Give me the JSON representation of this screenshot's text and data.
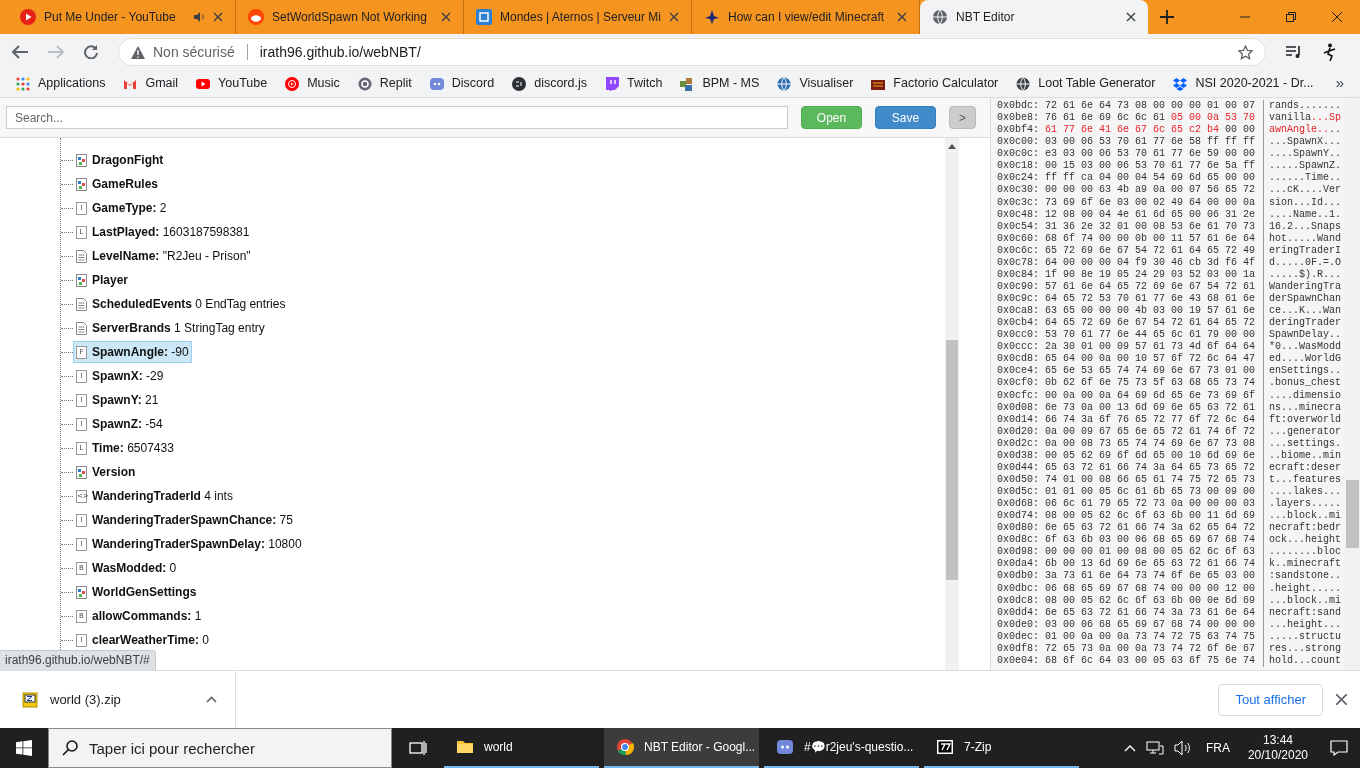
{
  "browser": {
    "tabs": [
      {
        "title": "Put Me Under - YouTube",
        "selected": false,
        "audio": true
      },
      {
        "title": "SetWorldSpawn Not Working",
        "selected": false,
        "audio": false
      },
      {
        "title": "Mondes | Aternos | Serveur Mi",
        "selected": false,
        "audio": false
      },
      {
        "title": "How can I view/edit Minecraft",
        "selected": false,
        "audio": false
      },
      {
        "title": "NBT Editor",
        "selected": true,
        "audio": false
      }
    ],
    "security": "Non sécurisé",
    "url": "irath96.github.io/webNBT/",
    "bookmarks": [
      {
        "label": "Applications"
      },
      {
        "label": "Gmail"
      },
      {
        "label": "YouTube"
      },
      {
        "label": "Music"
      },
      {
        "label": "Replit"
      },
      {
        "label": "Discord"
      },
      {
        "label": "discord.js"
      },
      {
        "label": "Twitch"
      },
      {
        "label": "BPM - MS"
      },
      {
        "label": "Visualiser"
      },
      {
        "label": "Factorio Calculator"
      },
      {
        "label": "Loot Table Generator"
      },
      {
        "label": "NSI 2020-2021 - Dr..."
      }
    ],
    "more": "»"
  },
  "toolbar": {
    "search": {
      "placeholder": "Search..."
    },
    "buttons": [
      {
        "label": "Open",
        "kind": "open"
      },
      {
        "label": "Save",
        "kind": "save"
      },
      {
        "label": ">",
        "kind": "toggle"
      }
    ]
  },
  "tree": {
    "items": [
      {
        "kind": "compound",
        "name": "DragonFight",
        "selected": false
      },
      {
        "kind": "compound",
        "name": "GameRules",
        "selected": false
      },
      {
        "kind": "tag",
        "letter": "I",
        "name": "GameType:",
        "value": "2",
        "selected": false
      },
      {
        "kind": "tag",
        "letter": "L",
        "name": "LastPlayed:",
        "value": "1603187598381",
        "selected": false
      },
      {
        "kind": "page",
        "name": "LevelName:",
        "value": "\"R2Jeu - Prison\"",
        "selected": false
      },
      {
        "kind": "compound",
        "name": "Player",
        "selected": false
      },
      {
        "kind": "page",
        "name": "ScheduledEvents",
        "value": "0 EndTag entries",
        "selected": false
      },
      {
        "kind": "page",
        "name": "ServerBrands",
        "value": "1 StringTag entry",
        "selected": false
      },
      {
        "kind": "tag",
        "letter": "F",
        "name": "SpawnAngle:",
        "value": "-90",
        "selected": true
      },
      {
        "kind": "tag",
        "letter": "I",
        "name": "SpawnX:",
        "value": "-29",
        "selected": false
      },
      {
        "kind": "tag",
        "letter": "I",
        "name": "SpawnY:",
        "value": "21",
        "selected": false
      },
      {
        "kind": "tag",
        "letter": "I",
        "name": "SpawnZ:",
        "value": "-54",
        "selected": false
      },
      {
        "kind": "tag",
        "letter": "L",
        "name": "Time:",
        "value": "6507433",
        "selected": false
      },
      {
        "kind": "compound",
        "name": "Version",
        "selected": false
      },
      {
        "kind": "tag",
        "letter": "<>",
        "name": "WanderingTraderId",
        "value": "4 ints",
        "selected": false
      },
      {
        "kind": "tag",
        "letter": "I",
        "name": "WanderingTraderSpawnChance:",
        "value": "75",
        "selected": false
      },
      {
        "kind": "tag",
        "letter": "I",
        "name": "WanderingTraderSpawnDelay:",
        "value": "10800",
        "selected": false
      },
      {
        "kind": "tag",
        "letter": "B",
        "name": "WasModded:",
        "value": "0",
        "selected": false
      },
      {
        "kind": "compound",
        "name": "WorldGenSettings",
        "selected": false
      },
      {
        "kind": "tag",
        "letter": "B",
        "name": "allowCommands:",
        "value": "1",
        "selected": false
      },
      {
        "kind": "tag",
        "letter": "I",
        "name": "clearWeatherTime:",
        "value": "0",
        "selected": false
      }
    ]
  },
  "hex": {
    "rows": [
      {
        "offset": "0x0bdc:",
        "hex": [
          {
            "text": "72 61 6e 64 73 08 00 00 00 01 00 07",
            "marked": false
          }
        ],
        "ascii": [
          {
            "text": "rands.......",
            "marked": false
          }
        ]
      },
      {
        "offset": "0x0be8:",
        "hex": [
          {
            "text": "76 61 6e 69 6c 6c 61",
            "marked": false
          },
          {
            "text": "05 00 0a 53 70",
            "marked": true
          }
        ],
        "ascii": [
          {
            "text": "vanilla",
            "marked": false
          },
          {
            "text": "...Sp",
            "marked": true
          }
        ]
      },
      {
        "offset": "0x0bf4:",
        "hex": [
          {
            "text": "61 77 6e 41 6e 67 6c 65 c2 b4",
            "marked": true
          },
          {
            "text": "00 00",
            "marked": false
          }
        ],
        "ascii": [
          {
            "text": "awnAngle..",
            "marked": true
          },
          {
            "text": "..",
            "marked": false
          }
        ]
      },
      {
        "offset": "0x0c00:",
        "hex": [
          {
            "text": "03 00 06 53 70 61 77 6e 58 ff ff ff",
            "marked": false
          }
        ],
        "ascii": [
          {
            "text": "...SpawnX...",
            "marked": false
          }
        ]
      },
      {
        "offset": "0x0c0c:",
        "hex": [
          {
            "text": "e3 03 00 06 53 70 61 77 6e 59 00 00",
            "marked": false
          }
        ],
        "ascii": [
          {
            "text": "....SpawnY..",
            "marked": false
          }
        ]
      },
      {
        "offset": "0x0c18:",
        "hex": [
          {
            "text": "00 15 03 00 06 53 70 61 77 6e 5a ff",
            "marked": false
          }
        ],
        "ascii": [
          {
            "text": ".....SpawnZ.",
            "marked": false
          }
        ]
      },
      {
        "offset": "0x0c24:",
        "hex": [
          {
            "text": "ff ff ca 04 00 04 54 69 6d 65 00 00",
            "marked": false
          }
        ],
        "ascii": [
          {
            "text": "......Time..",
            "marked": false
          }
        ]
      },
      {
        "offset": "0x0c30:",
        "hex": [
          {
            "text": "00 00 00 63 4b a9 0a 00 07 56 65 72",
            "marked": false
          }
        ],
        "ascii": [
          {
            "text": "...cK....Ver",
            "marked": false
          }
        ]
      },
      {
        "offset": "0x0c3c:",
        "hex": [
          {
            "text": "73 69 6f 6e 03 00 02 49 64 00 00 0a",
            "marked": false
          }
        ],
        "ascii": [
          {
            "text": "sion...Id...",
            "marked": false
          }
        ]
      },
      {
        "offset": "0x0c48:",
        "hex": [
          {
            "text": "12 08 00 04 4e 61 6d 65 00 06 31 2e",
            "marked": false
          }
        ],
        "ascii": [
          {
            "text": "....Name..1.",
            "marked": false
          }
        ]
      },
      {
        "offset": "0x0c54:",
        "hex": [
          {
            "text": "31 36 2e 32 01 00 08 53 6e 61 70 73",
            "marked": false
          }
        ],
        "ascii": [
          {
            "text": "16.2...Snaps",
            "marked": false
          }
        ]
      },
      {
        "offset": "0x0c60:",
        "hex": [
          {
            "text": "68 6f 74 00 00 0b 00 11 57 61 6e 64",
            "marked": false
          }
        ],
        "ascii": [
          {
            "text": "hot.....Wand",
            "marked": false
          }
        ]
      },
      {
        "offset": "0x0c6c:",
        "hex": [
          {
            "text": "65 72 69 6e 67 54 72 61 64 65 72 49",
            "marked": false
          }
        ],
        "ascii": [
          {
            "text": "eringTraderI",
            "marked": false
          }
        ]
      },
      {
        "offset": "0x0c78:",
        "hex": [
          {
            "text": "64 00 00 00 04 f9 30 46 cb 3d f6 4f",
            "marked": false
          }
        ],
        "ascii": [
          {
            "text": "d.....0F.=.O",
            "marked": false
          }
        ]
      },
      {
        "offset": "0x0c84:",
        "hex": [
          {
            "text": "1f 90 8e 19 05 24 29 03 52 03 00 1a",
            "marked": false
          }
        ],
        "ascii": [
          {
            "text": ".....$).R...",
            "marked": false
          }
        ]
      },
      {
        "offset": "0x0c90:",
        "hex": [
          {
            "text": "57 61 6e 64 65 72 69 6e 67 54 72 61",
            "marked": false
          }
        ],
        "ascii": [
          {
            "text": "WanderingTra",
            "marked": false
          }
        ]
      },
      {
        "offset": "0x0c9c:",
        "hex": [
          {
            "text": "64 65 72 53 70 61 77 6e 43 68 61 6e",
            "marked": false
          }
        ],
        "ascii": [
          {
            "text": "derSpawnChan",
            "marked": false
          }
        ]
      },
      {
        "offset": "0x0ca8:",
        "hex": [
          {
            "text": "63 65 00 00 00 4b 03 00 19 57 61 6e",
            "marked": false
          }
        ],
        "ascii": [
          {
            "text": "ce...K...Wan",
            "marked": false
          }
        ]
      },
      {
        "offset": "0x0cb4:",
        "hex": [
          {
            "text": "64 65 72 69 6e 67 54 72 61 64 65 72",
            "marked": false
          }
        ],
        "ascii": [
          {
            "text": "deringTrader",
            "marked": false
          }
        ]
      },
      {
        "offset": "0x0cc0:",
        "hex": [
          {
            "text": "53 70 61 77 6e 44 65 6c 61 79 00 00",
            "marked": false
          }
        ],
        "ascii": [
          {
            "text": "SpawnDelay..",
            "marked": false
          }
        ]
      },
      {
        "offset": "0x0ccc:",
        "hex": [
          {
            "text": "2a 30 01 00 09 57 61 73 4d 6f 64 64",
            "marked": false
          }
        ],
        "ascii": [
          {
            "text": "*0...WasModd",
            "marked": false
          }
        ]
      },
      {
        "offset": "0x0cd8:",
        "hex": [
          {
            "text": "65 64 00 0a 00 10 57 6f 72 6c 64 47",
            "marked": false
          }
        ],
        "ascii": [
          {
            "text": "ed....WorldG",
            "marked": false
          }
        ]
      },
      {
        "offset": "0x0ce4:",
        "hex": [
          {
            "text": "65 6e 53 65 74 74 69 6e 67 73 01 00",
            "marked": false
          }
        ],
        "ascii": [
          {
            "text": "enSettings..",
            "marked": false
          }
        ]
      },
      {
        "offset": "0x0cf0:",
        "hex": [
          {
            "text": "0b 62 6f 6e 75 73 5f 63 68 65 73 74",
            "marked": false
          }
        ],
        "ascii": [
          {
            "text": ".bonus_chest",
            "marked": false
          }
        ]
      },
      {
        "offset": "0x0cfc:",
        "hex": [
          {
            "text": "00 0a 00 0a 64 69 6d 65 6e 73 69 6f",
            "marked": false
          }
        ],
        "ascii": [
          {
            "text": "....dimensio",
            "marked": false
          }
        ]
      },
      {
        "offset": "0x0d08:",
        "hex": [
          {
            "text": "6e 73 0a 00 13 6d 69 6e 65 63 72 61",
            "marked": false
          }
        ],
        "ascii": [
          {
            "text": "ns...minecra",
            "marked": false
          }
        ]
      },
      {
        "offset": "0x0d14:",
        "hex": [
          {
            "text": "66 74 3a 6f 76 65 72 77 6f 72 6c 64",
            "marked": false
          }
        ],
        "ascii": [
          {
            "text": "ft:overworld",
            "marked": false
          }
        ]
      },
      {
        "offset": "0x0d20:",
        "hex": [
          {
            "text": "0a 00 09 67 65 6e 65 72 61 74 6f 72",
            "marked": false
          }
        ],
        "ascii": [
          {
            "text": "...generator",
            "marked": false
          }
        ]
      },
      {
        "offset": "0x0d2c:",
        "hex": [
          {
            "text": "0a 00 08 73 65 74 74 69 6e 67 73 08",
            "marked": false
          }
        ],
        "ascii": [
          {
            "text": "...settings.",
            "marked": false
          }
        ]
      },
      {
        "offset": "0x0d38:",
        "hex": [
          {
            "text": "00 05 62 69 6f 6d 65 00 10 6d 69 6e",
            "marked": false
          }
        ],
        "ascii": [
          {
            "text": "..biome..min",
            "marked": false
          }
        ]
      },
      {
        "offset": "0x0d44:",
        "hex": [
          {
            "text": "65 63 72 61 66 74 3a 64 65 73 65 72",
            "marked": false
          }
        ],
        "ascii": [
          {
            "text": "ecraft:deser",
            "marked": false
          }
        ]
      },
      {
        "offset": "0x0d50:",
        "hex": [
          {
            "text": "74 01 00 08 66 65 61 74 75 72 65 73",
            "marked": false
          }
        ],
        "ascii": [
          {
            "text": "t...features",
            "marked": false
          }
        ]
      },
      {
        "offset": "0x0d5c:",
        "hex": [
          {
            "text": "01 01 00 05 6c 61 6b 65 73 00 09 00",
            "marked": false
          }
        ],
        "ascii": [
          {
            "text": "....lakes...",
            "marked": false
          }
        ]
      },
      {
        "offset": "0x0d68:",
        "hex": [
          {
            "text": "06 6c 61 79 65 72 73 0a 00 00 00 03",
            "marked": false
          }
        ],
        "ascii": [
          {
            "text": ".layers.....",
            "marked": false
          }
        ]
      },
      {
        "offset": "0x0d74:",
        "hex": [
          {
            "text": "08 00 05 62 6c 6f 63 6b 00 11 6d 69",
            "marked": false
          }
        ],
        "ascii": [
          {
            "text": "...block..mi",
            "marked": false
          }
        ]
      },
      {
        "offset": "0x0d80:",
        "hex": [
          {
            "text": "6e 65 63 72 61 66 74 3a 62 65 64 72",
            "marked": false
          }
        ],
        "ascii": [
          {
            "text": "necraft:bedr",
            "marked": false
          }
        ]
      },
      {
        "offset": "0x0d8c:",
        "hex": [
          {
            "text": "6f 63 6b 03 00 06 68 65 69 67 68 74",
            "marked": false
          }
        ],
        "ascii": [
          {
            "text": "ock...height",
            "marked": false
          }
        ]
      },
      {
        "offset": "0x0d98:",
        "hex": [
          {
            "text": "00 00 00 01 00 08 00 05 62 6c 6f 63",
            "marked": false
          }
        ],
        "ascii": [
          {
            "text": "........bloc",
            "marked": false
          }
        ]
      },
      {
        "offset": "0x0da4:",
        "hex": [
          {
            "text": "6b 00 13 6d 69 6e 65 63 72 61 66 74",
            "marked": false
          }
        ],
        "ascii": [
          {
            "text": "k..minecraft",
            "marked": false
          }
        ]
      },
      {
        "offset": "0x0db0:",
        "hex": [
          {
            "text": "3a 73 61 6e 64 73 74 6f 6e 65 03 00",
            "marked": false
          }
        ],
        "ascii": [
          {
            "text": ":sandstone..",
            "marked": false
          }
        ]
      },
      {
        "offset": "0x0dbc:",
        "hex": [
          {
            "text": "06 68 65 69 67 68 74 00 00 00 12 00",
            "marked": false
          }
        ],
        "ascii": [
          {
            "text": ".height.....",
            "marked": false
          }
        ]
      },
      {
        "offset": "0x0dc8:",
        "hex": [
          {
            "text": "08 00 05 62 6c 6f 63 6b 00 0e 6d 69",
            "marked": false
          }
        ],
        "ascii": [
          {
            "text": "...block..mi",
            "marked": false
          }
        ]
      },
      {
        "offset": "0x0dd4:",
        "hex": [
          {
            "text": "6e 65 63 72 61 66 74 3a 73 61 6e 64",
            "marked": false
          }
        ],
        "ascii": [
          {
            "text": "necraft:sand",
            "marked": false
          }
        ]
      },
      {
        "offset": "0x0de0:",
        "hex": [
          {
            "text": "03 00 06 68 65 69 67 68 74 00 00 00",
            "marked": false
          }
        ],
        "ascii": [
          {
            "text": "...height...",
            "marked": false
          }
        ]
      },
      {
        "offset": "0x0dec:",
        "hex": [
          {
            "text": "01 00 0a 00 0a 73 74 72 75 63 74 75",
            "marked": false
          }
        ],
        "ascii": [
          {
            "text": ".....structu",
            "marked": false
          }
        ]
      },
      {
        "offset": "0x0df8:",
        "hex": [
          {
            "text": "72 65 73 0a 00 0a 73 74 72 6f 6e 67",
            "marked": false
          }
        ],
        "ascii": [
          {
            "text": "res...strong",
            "marked": false
          }
        ]
      },
      {
        "offset": "0x0e04:",
        "hex": [
          {
            "text": "68 6f 6c 64 03 00 05 63 6f 75 6e 74",
            "marked": false
          }
        ],
        "ascii": [
          {
            "text": "hold...count",
            "marked": false
          }
        ]
      }
    ]
  },
  "status_url": "irath96.github.io/webNBT/#",
  "downloads": {
    "file": "world (3).zip",
    "show_all": "Tout afficher"
  },
  "taskbar": {
    "search": {
      "placeholder": "Taper ici pour rechercher"
    },
    "apps": [
      {
        "label": "world",
        "selected": false
      },
      {
        "label": "NBT Editor - Googl...",
        "selected": true
      },
      {
        "label": "#💬r2jeu's-questio...",
        "selected": false
      },
      {
        "label": "7-Zip",
        "selected": false
      }
    ],
    "language": "FRA",
    "time": "13:44",
    "date": "20/10/2020"
  }
}
